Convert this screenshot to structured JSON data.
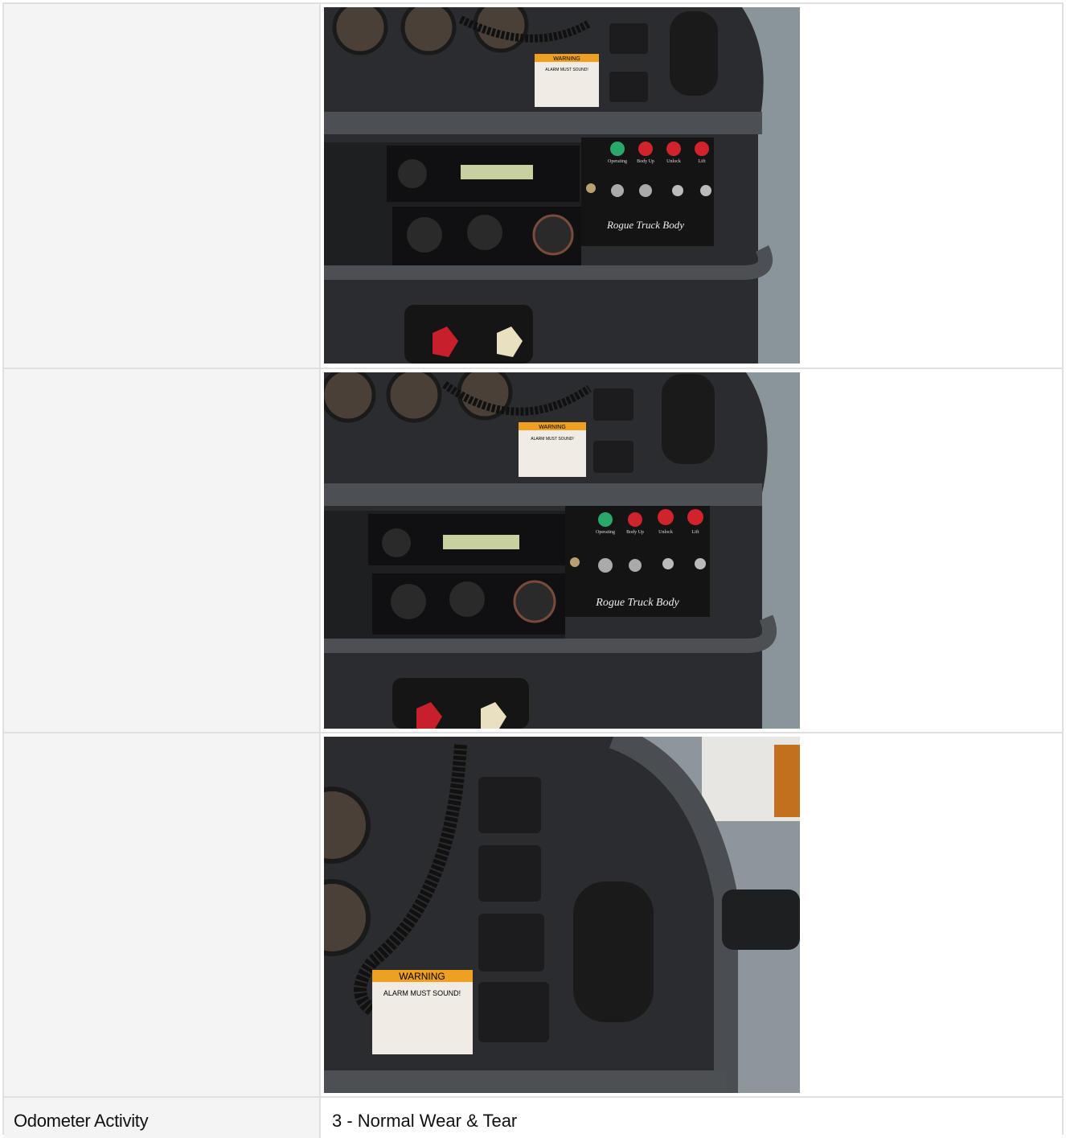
{
  "rows": [
    {
      "label": "",
      "photo": {
        "alt": "Dashboard photo 1",
        "warning_title": "WARNING",
        "warning_subtitle": "ALARM MUST SOUND!",
        "panel_labels": [
          "Operating",
          "Body Up",
          "Unlock",
          "Lift"
        ],
        "panel_brand": "Rogue Truck Body"
      }
    },
    {
      "label": "",
      "photo": {
        "alt": "Dashboard photo 2",
        "warning_title": "WARNING",
        "warning_subtitle": "ALARM MUST SOUND!",
        "panel_labels": [
          "Operating",
          "Body Up",
          "Unlock",
          "Lift"
        ],
        "panel_brand": "Rogue Truck Body"
      }
    },
    {
      "label": "",
      "photo": {
        "alt": "Dashboard photo 3",
        "warning_title": "WARNING",
        "warning_subtitle": "ALARM MUST SOUND!"
      }
    }
  ],
  "odometer": {
    "label": "Odometer Activity",
    "value": "3 - Normal Wear & Tear"
  },
  "colors": {
    "label_bg": "#f4f4f4",
    "border": "#e0e0e0",
    "dash_dark": "#2b2d30",
    "warning_orange": "#f0a020",
    "led_green": "#2aa86a",
    "led_red": "#d0232c"
  }
}
